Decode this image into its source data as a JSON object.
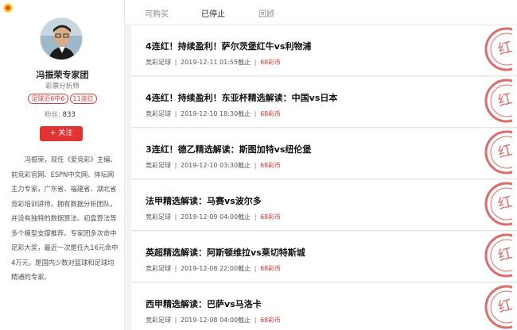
{
  "profile": {
    "name": "冯振荣专家团",
    "role": "彩票分析师",
    "tags": [
      "足球近6中6",
      "11连红"
    ],
    "fans_label": "粉丝:",
    "fans_count": "833",
    "follow_label": "+ 关注",
    "bio": "冯振荣，现任《爱竞彩》主编、前竞彩官网、ESPN中文网、体坛网主力专家，广东省、福建省、湖北省竞彩培训讲师。拥有数据分析团队，并设有独特的数据算法、初盘算法等多个模型支撑推荐。专家团多次命中足彩大奖，最近一次是任九16元命中4万元，是国内少数对篮球和足球均精通的专家。"
  },
  "tabs": [
    {
      "label": "可购买",
      "active": false
    },
    {
      "label": "已停止",
      "active": true
    },
    {
      "label": "回顾",
      "active": false
    }
  ],
  "items": [
    {
      "title": "4连红！持续盈利！萨尔茨堡红牛vs利物浦",
      "category": "竞彩足球",
      "deadline": "2019-12-11 01:55截止",
      "price": "68彩币",
      "stamp": "红"
    },
    {
      "title": "4连红！持续盈利！东亚杯精选解读：中国vs日本",
      "category": "竞彩足球",
      "deadline": "2019-12-10 18:30截止",
      "price": "68彩币",
      "stamp": "红"
    },
    {
      "title": "3连红！德乙精选解读：斯图加特vs纽伦堡",
      "category": "竞彩足球",
      "deadline": "2019-12-10 03:30截止",
      "price": "68彩币",
      "stamp": "红"
    },
    {
      "title": "法甲精选解读：马赛vs波尔多",
      "category": "竞彩足球",
      "deadline": "2019-12-09 04:00截止",
      "price": "68彩币",
      "stamp": "红"
    },
    {
      "title": "英超精选解读：阿斯顿维拉vs莱切特斯城",
      "category": "竞彩足球",
      "deadline": "2019-12-08 22:00截止",
      "price": "68彩币",
      "stamp": "红"
    },
    {
      "title": "西甲精选解读：巴萨vs马洛卡",
      "category": "竞彩足球",
      "deadline": "2019-12-08 04:00截止",
      "price": "68彩币",
      "stamp": "红"
    }
  ],
  "colors": {
    "accent": "#e23333",
    "stamp": "#d9534f"
  },
  "icons": {
    "logo": "sunflower-logo-icon",
    "stamp": "red-hit-stamp-icon"
  }
}
